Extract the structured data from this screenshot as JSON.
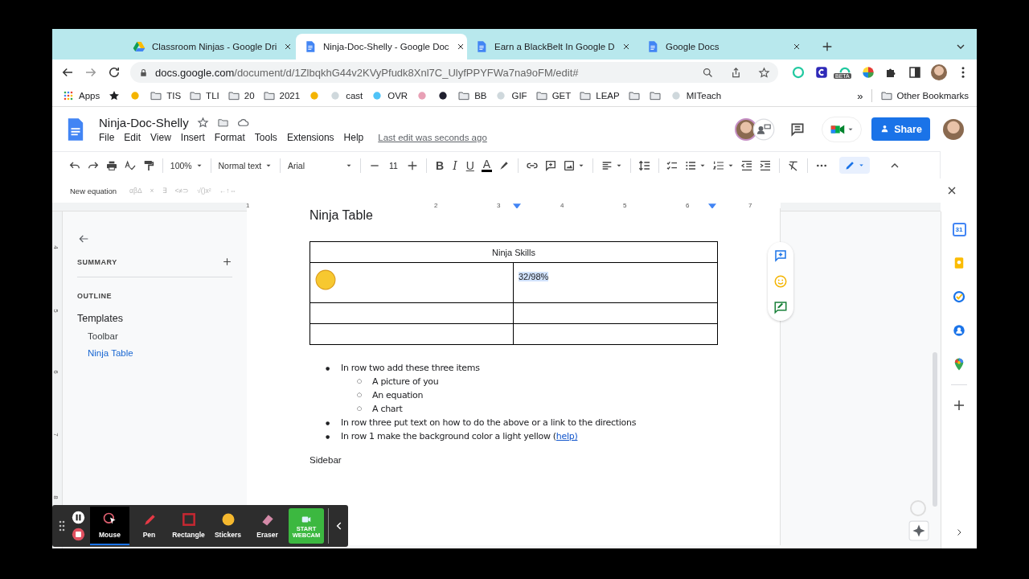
{
  "browser": {
    "tabs": [
      {
        "title": "Classroom Ninjas - Google Dri",
        "kind": "drive",
        "selected": false
      },
      {
        "title": "Ninja-Doc-Shelly - Google Doc",
        "kind": "docs",
        "selected": true
      },
      {
        "title": "Earn a BlackBelt In Google D",
        "kind": "docs",
        "selected": false
      },
      {
        "title": "Google Docs",
        "kind": "docs",
        "selected": false
      }
    ],
    "address": {
      "host": "docs.google.com",
      "path": "/document/d/1ZlbqkhG44v2KVyPfudk8Xnl7C_UlyfPPYFWa7na9oFM/edit#"
    },
    "extension_badge": "BETA",
    "bookmarks": [
      {
        "kind": "apps",
        "label": "Apps"
      },
      {
        "kind": "star"
      },
      {
        "kind": "site"
      },
      {
        "kind": "folder",
        "label": "TIS"
      },
      {
        "kind": "folder",
        "label": "TLI"
      },
      {
        "kind": "folder",
        "label": "20"
      },
      {
        "kind": "folder",
        "label": "2021"
      },
      {
        "kind": "site"
      },
      {
        "kind": "site",
        "label": "cast"
      },
      {
        "kind": "site",
        "label": "OVR"
      },
      {
        "kind": "site"
      },
      {
        "kind": "site"
      },
      {
        "kind": "folder",
        "label": "BB"
      },
      {
        "kind": "site",
        "label": "GIF"
      },
      {
        "kind": "folder",
        "label": "GET"
      },
      {
        "kind": "folder",
        "label": "LEAP"
      },
      {
        "kind": "folder"
      },
      {
        "kind": "folder"
      },
      {
        "kind": "site",
        "label": "MITeach"
      }
    ],
    "bookmarks_overflow": "»",
    "other_bookmarks": "Other Bookmarks"
  },
  "doc": {
    "title": "Ninja-Doc-Shelly",
    "menus": [
      "File",
      "Edit",
      "View",
      "Insert",
      "Format",
      "Tools",
      "Extensions",
      "Help"
    ],
    "last_edit": "Last edit was seconds ago",
    "share": "Share"
  },
  "toolbar": {
    "zoom": "100%",
    "style": "Normal text",
    "font": "Arial",
    "font_size": "11",
    "format": [
      "B",
      "I",
      "U",
      "A"
    ]
  },
  "equation_bar": {
    "label": "New equation",
    "groups": [
      "αβΔ",
      "×",
      "∃",
      "<≠⊃",
      "√()x²",
      "←↑⇔"
    ]
  },
  "ruler": {
    "horizontal": [
      "1",
      "2",
      "3",
      "4",
      "5",
      "6",
      "7"
    ],
    "vertical": [
      "4",
      "5",
      "6",
      "7",
      "8"
    ]
  },
  "sidebar": {
    "summary": "SUMMARY",
    "outline": "OUTLINE",
    "items": [
      {
        "label": "Templates",
        "selected": false,
        "children": [
          {
            "label": "Toolbar",
            "selected": false
          },
          {
            "label": "Ninja Table",
            "selected": true
          }
        ]
      }
    ]
  },
  "document": {
    "heading": "Ninja Table",
    "table": {
      "header": "Ninja Skills",
      "rows": [
        {
          "kind": "content",
          "text": "32/98%",
          "selected": true
        },
        {
          "kind": "empty"
        },
        {
          "kind": "empty"
        }
      ]
    },
    "bullets": [
      {
        "marker": "●",
        "text": "In row two add these three items",
        "children": [
          {
            "marker": "○",
            "text": "A picture of you"
          },
          {
            "marker": "○",
            "text": "An equation"
          },
          {
            "marker": "○",
            "text": "A chart"
          }
        ]
      },
      {
        "marker": "●",
        "text": "In row three put text on how to do the above or a link to the directions"
      },
      {
        "marker": "●",
        "text": "In row 1 make the background color a light yellow (",
        "link": "help)"
      }
    ],
    "footer_text": "Sidebar"
  },
  "rail": {
    "calendar_day": "31"
  },
  "recorder": {
    "tools": [
      {
        "label": "Mouse",
        "kind": "mouse",
        "selected": true
      },
      {
        "label": "Pen",
        "kind": "pen",
        "selected": false
      },
      {
        "label": "Rectangle",
        "kind": "rectangle",
        "selected": false
      },
      {
        "label": "Stickers",
        "kind": "stickers",
        "selected": false
      },
      {
        "label": "Eraser",
        "kind": "eraser",
        "selected": false
      }
    ],
    "webcam": "START WEBCAM"
  }
}
